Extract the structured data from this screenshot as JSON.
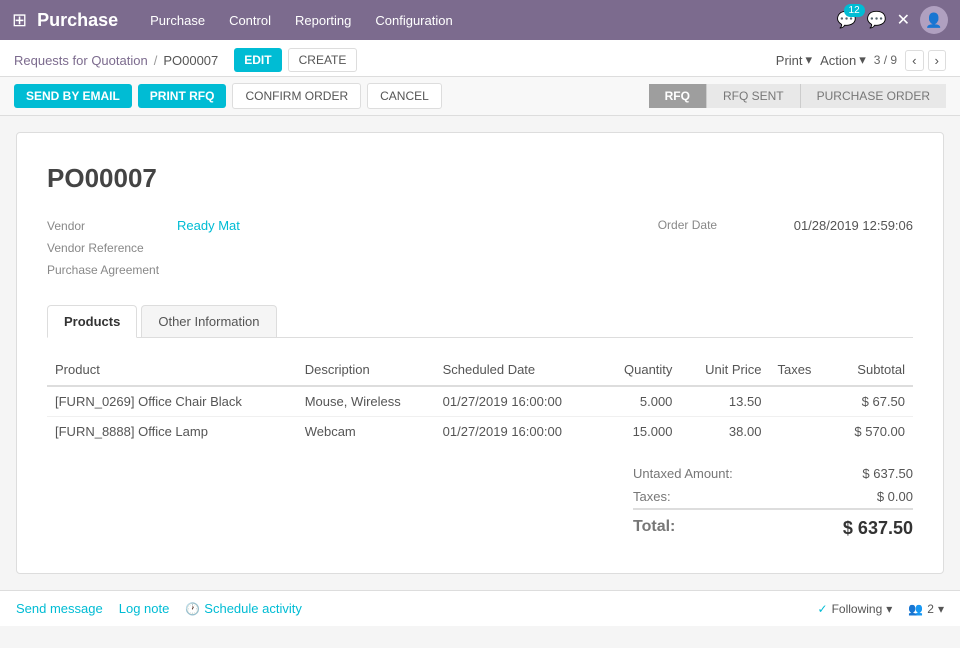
{
  "app": {
    "grid_icon": "⊞",
    "title": "Purchase"
  },
  "nav": {
    "links": [
      "Purchase",
      "Control",
      "Reporting",
      "Configuration"
    ]
  },
  "nav_right": {
    "badge_count": "12",
    "avatar_icon": "👤"
  },
  "breadcrumb": {
    "parent": "Requests for Quotation",
    "separator": "/",
    "current": "PO00007"
  },
  "breadcrumb_buttons": {
    "edit": "EDIT",
    "create": "CREATE"
  },
  "print_action": {
    "print": "Print",
    "action": "Action"
  },
  "pagination": {
    "current": "3",
    "total": "9",
    "display": "3 / 9"
  },
  "action_buttons": {
    "send_by_email": "SEND BY EMAIL",
    "print_rfq": "PRINT RFQ",
    "confirm_order": "CONFIRM ORDER",
    "cancel": "CANCEL"
  },
  "status_steps": [
    {
      "label": "RFQ",
      "active": true
    },
    {
      "label": "RFQ SENT",
      "active": false
    },
    {
      "label": "PURCHASE ORDER",
      "active": false
    }
  ],
  "document": {
    "number": "PO00007",
    "vendor_label": "Vendor",
    "vendor_value": "Ready Mat",
    "vendor_ref_label": "Vendor Reference",
    "purchase_agreement_label": "Purchase Agreement",
    "order_date_label": "Order Date",
    "order_date_value": "01/28/2019 12:59:06"
  },
  "tabs": [
    {
      "label": "Products",
      "active": true
    },
    {
      "label": "Other Information",
      "active": false
    }
  ],
  "table": {
    "headers": [
      "Product",
      "Description",
      "Scheduled Date",
      "Quantity",
      "Unit Price",
      "Taxes",
      "Subtotal"
    ],
    "rows": [
      {
        "product": "[FURN_0269] Office Chair Black",
        "description": "Mouse, Wireless",
        "scheduled_date": "01/27/2019 16:00:00",
        "quantity": "5.000",
        "unit_price": "13.50",
        "taxes": "",
        "subtotal": "$ 67.50"
      },
      {
        "product": "[FURN_8888] Office Lamp",
        "description": "Webcam",
        "scheduled_date": "01/27/2019 16:00:00",
        "quantity": "15.000",
        "unit_price": "38.00",
        "taxes": "",
        "subtotal": "$ 570.00"
      }
    ]
  },
  "totals": {
    "untaxed_label": "Untaxed Amount:",
    "untaxed_value": "$ 637.50",
    "taxes_label": "Taxes:",
    "taxes_value": "$ 0.00",
    "total_label": "Total:",
    "total_value": "$ 637.50"
  },
  "footer": {
    "send_message": "Send message",
    "log_note": "Log note",
    "schedule_activity": "Schedule activity",
    "following": "Following",
    "followers_count": "2"
  }
}
